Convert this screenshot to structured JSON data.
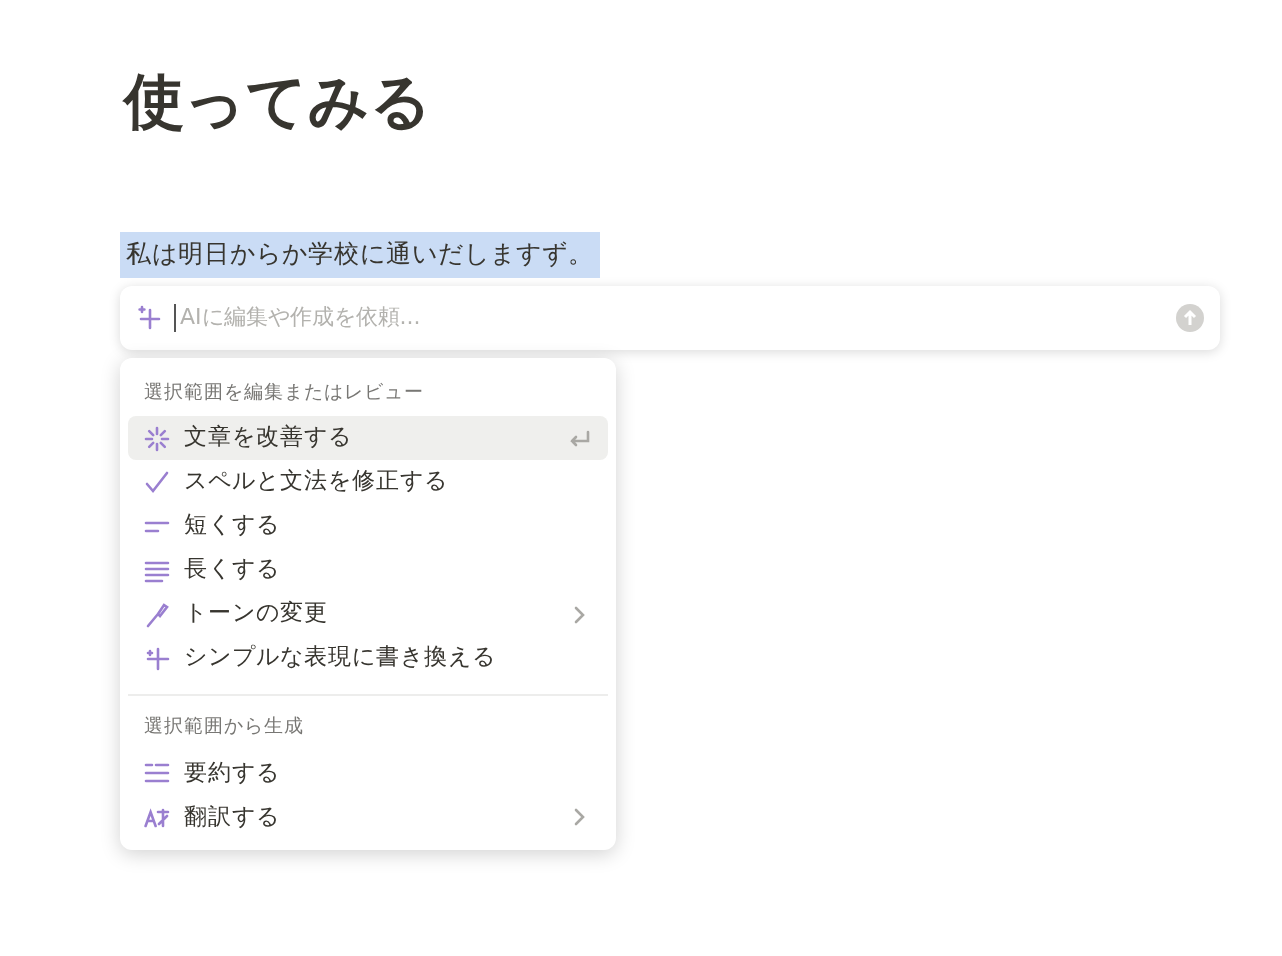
{
  "page": {
    "title": "使ってみる",
    "selected_text": "私は明日からか学校に通いだしますず。"
  },
  "ai_input": {
    "placeholder": "AIに編集や作成を依頼..."
  },
  "menu": {
    "sections": [
      {
        "heading": "選択範囲を編集またはレビュー",
        "items": [
          {
            "label": "文章を改善する",
            "selected": true,
            "kind": "enter"
          },
          {
            "label": "スペルと文法を修正する",
            "selected": false,
            "kind": "plain"
          },
          {
            "label": "短くする",
            "selected": false,
            "kind": "plain"
          },
          {
            "label": "長くする",
            "selected": false,
            "kind": "plain"
          },
          {
            "label": "トーンの変更",
            "selected": false,
            "kind": "submenu"
          },
          {
            "label": "シンプルな表現に書き換える",
            "selected": false,
            "kind": "plain"
          }
        ]
      },
      {
        "heading": "選択範囲から生成",
        "items": [
          {
            "label": "要約する",
            "selected": false,
            "kind": "plain"
          },
          {
            "label": "翻訳する",
            "selected": false,
            "kind": "submenu"
          }
        ]
      }
    ]
  }
}
